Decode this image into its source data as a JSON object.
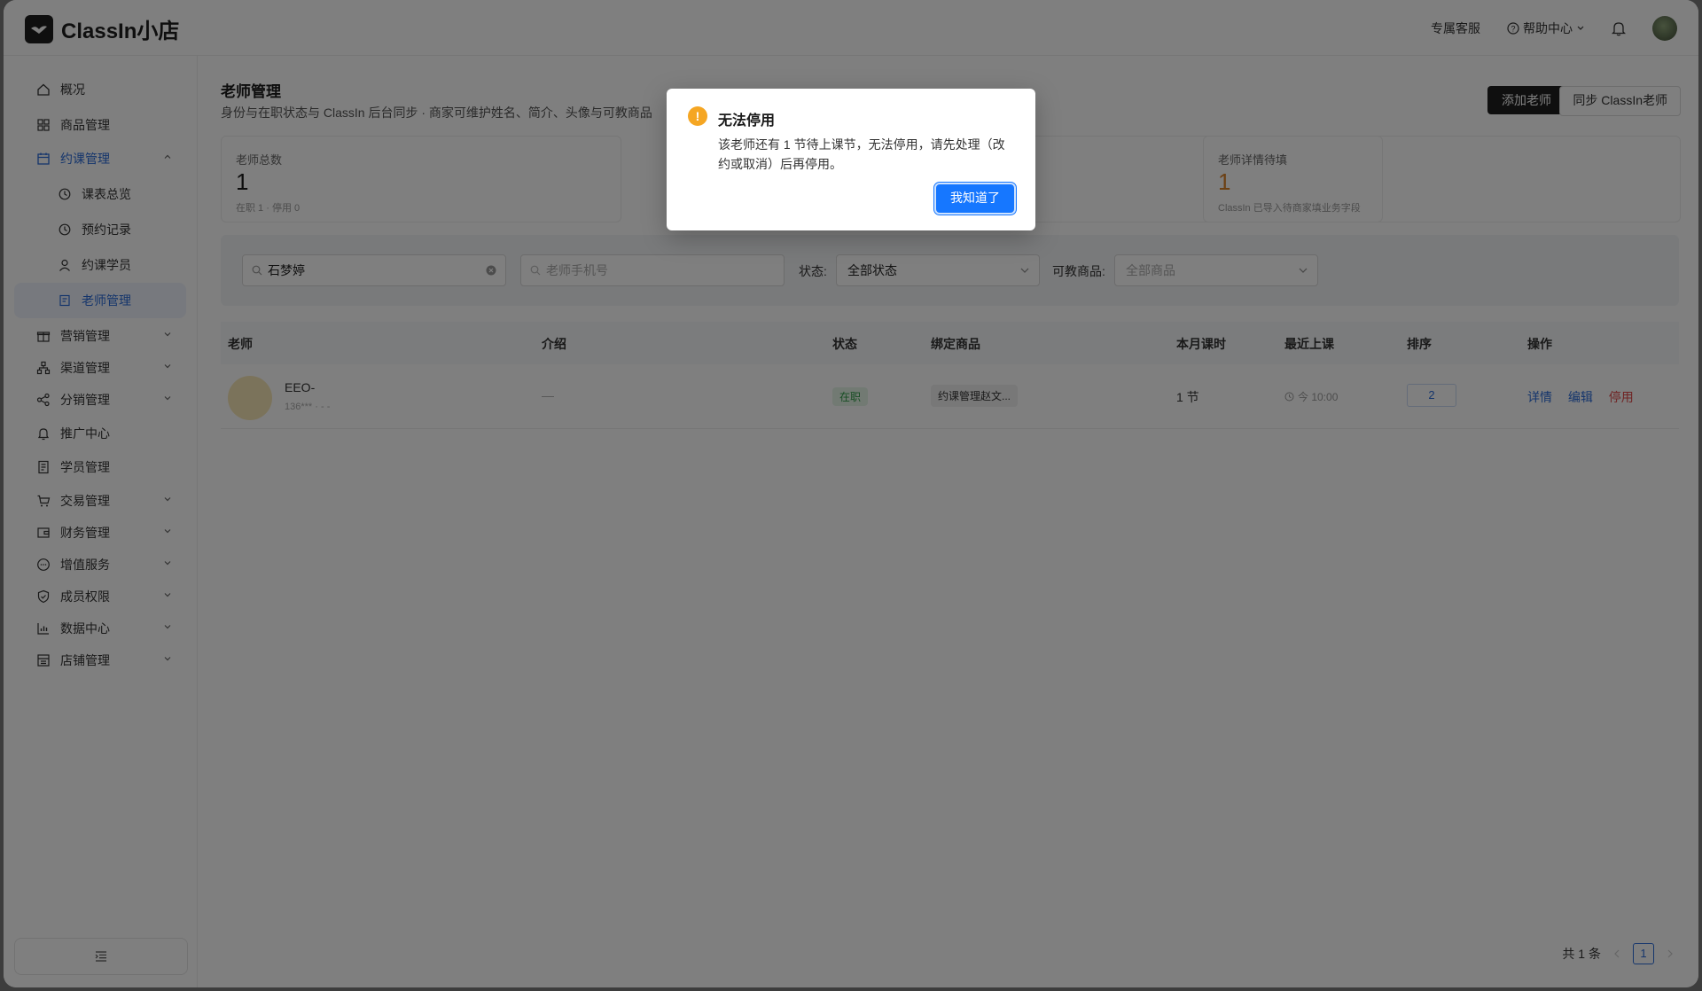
{
  "app": {
    "brand": "ClassIn小店"
  },
  "topbar": {
    "service": "专属客服",
    "help": "帮助中心"
  },
  "sidebar": {
    "items": [
      {
        "label": "概况",
        "icon": "home-icon"
      },
      {
        "label": "商品管理",
        "icon": "grid-icon"
      },
      {
        "label": "约课管理",
        "icon": "calendar-icon"
      },
      {
        "label": "课表总览",
        "icon": "clock-icon"
      },
      {
        "label": "预约记录",
        "icon": "clock-icon"
      },
      {
        "label": "约课学员",
        "icon": "user-icon"
      },
      {
        "label": "老师管理",
        "icon": "teacher-icon"
      },
      {
        "label": "营销管理",
        "icon": "gift-icon"
      },
      {
        "label": "渠道管理",
        "icon": "hierarchy-icon"
      },
      {
        "label": "分销管理",
        "icon": "share-icon"
      },
      {
        "label": "推广中心",
        "icon": "bell-icon"
      },
      {
        "label": "学员管理",
        "icon": "document-icon"
      },
      {
        "label": "交易管理",
        "icon": "cart-icon"
      },
      {
        "label": "财务管理",
        "icon": "wallet-icon"
      },
      {
        "label": "增值服务",
        "icon": "chat-icon"
      },
      {
        "label": "成员权限",
        "icon": "shield-icon"
      },
      {
        "label": "数据中心",
        "icon": "bar-chart-icon"
      },
      {
        "label": "店铺管理",
        "icon": "store-icon"
      }
    ]
  },
  "page": {
    "title": "老师管理",
    "subtitle": "身份与在职状态与 ClassIn 后台同步 · 商家可维护姓名、简介、头像与可教商品",
    "add_button": "添加老师",
    "sync_button": "同步 ClassIn老师"
  },
  "stats": [
    {
      "label": "老师总数",
      "value": "1",
      "hint": "在职 1 · 停用 0"
    },
    {
      "label": "老师详情待填",
      "value": "1",
      "hint": "ClassIn 已导入待商家填业务字段"
    }
  ],
  "filters": {
    "name_value": "石梦婷",
    "phone_placeholder": "老师手机号",
    "status_label": "状态:",
    "status_value": "全部状态",
    "product_label": "可教商品:",
    "product_placeholder": "全部商品"
  },
  "table": {
    "headers": [
      "老师",
      "介绍",
      "状态",
      "绑定商品",
      "本月课时",
      "最近上课",
      "排序",
      "操作"
    ],
    "rows": [
      {
        "name": "EEO-",
        "phone": "136*** · - -",
        "intro": "—",
        "status": "在职",
        "product": "约课管理赵文...",
        "hours": "1 节",
        "recent": "今 10:00",
        "sort": "2",
        "ops": [
          "详情",
          "编辑",
          "停用"
        ]
      }
    ]
  },
  "pagination": {
    "total": "共 1 条",
    "current": "1"
  },
  "modal": {
    "title": "无法停用",
    "body": "该老师还有 1 节待上课节，无法停用，请先处理（改约或取消）后再停用。",
    "button": "我知道了"
  }
}
